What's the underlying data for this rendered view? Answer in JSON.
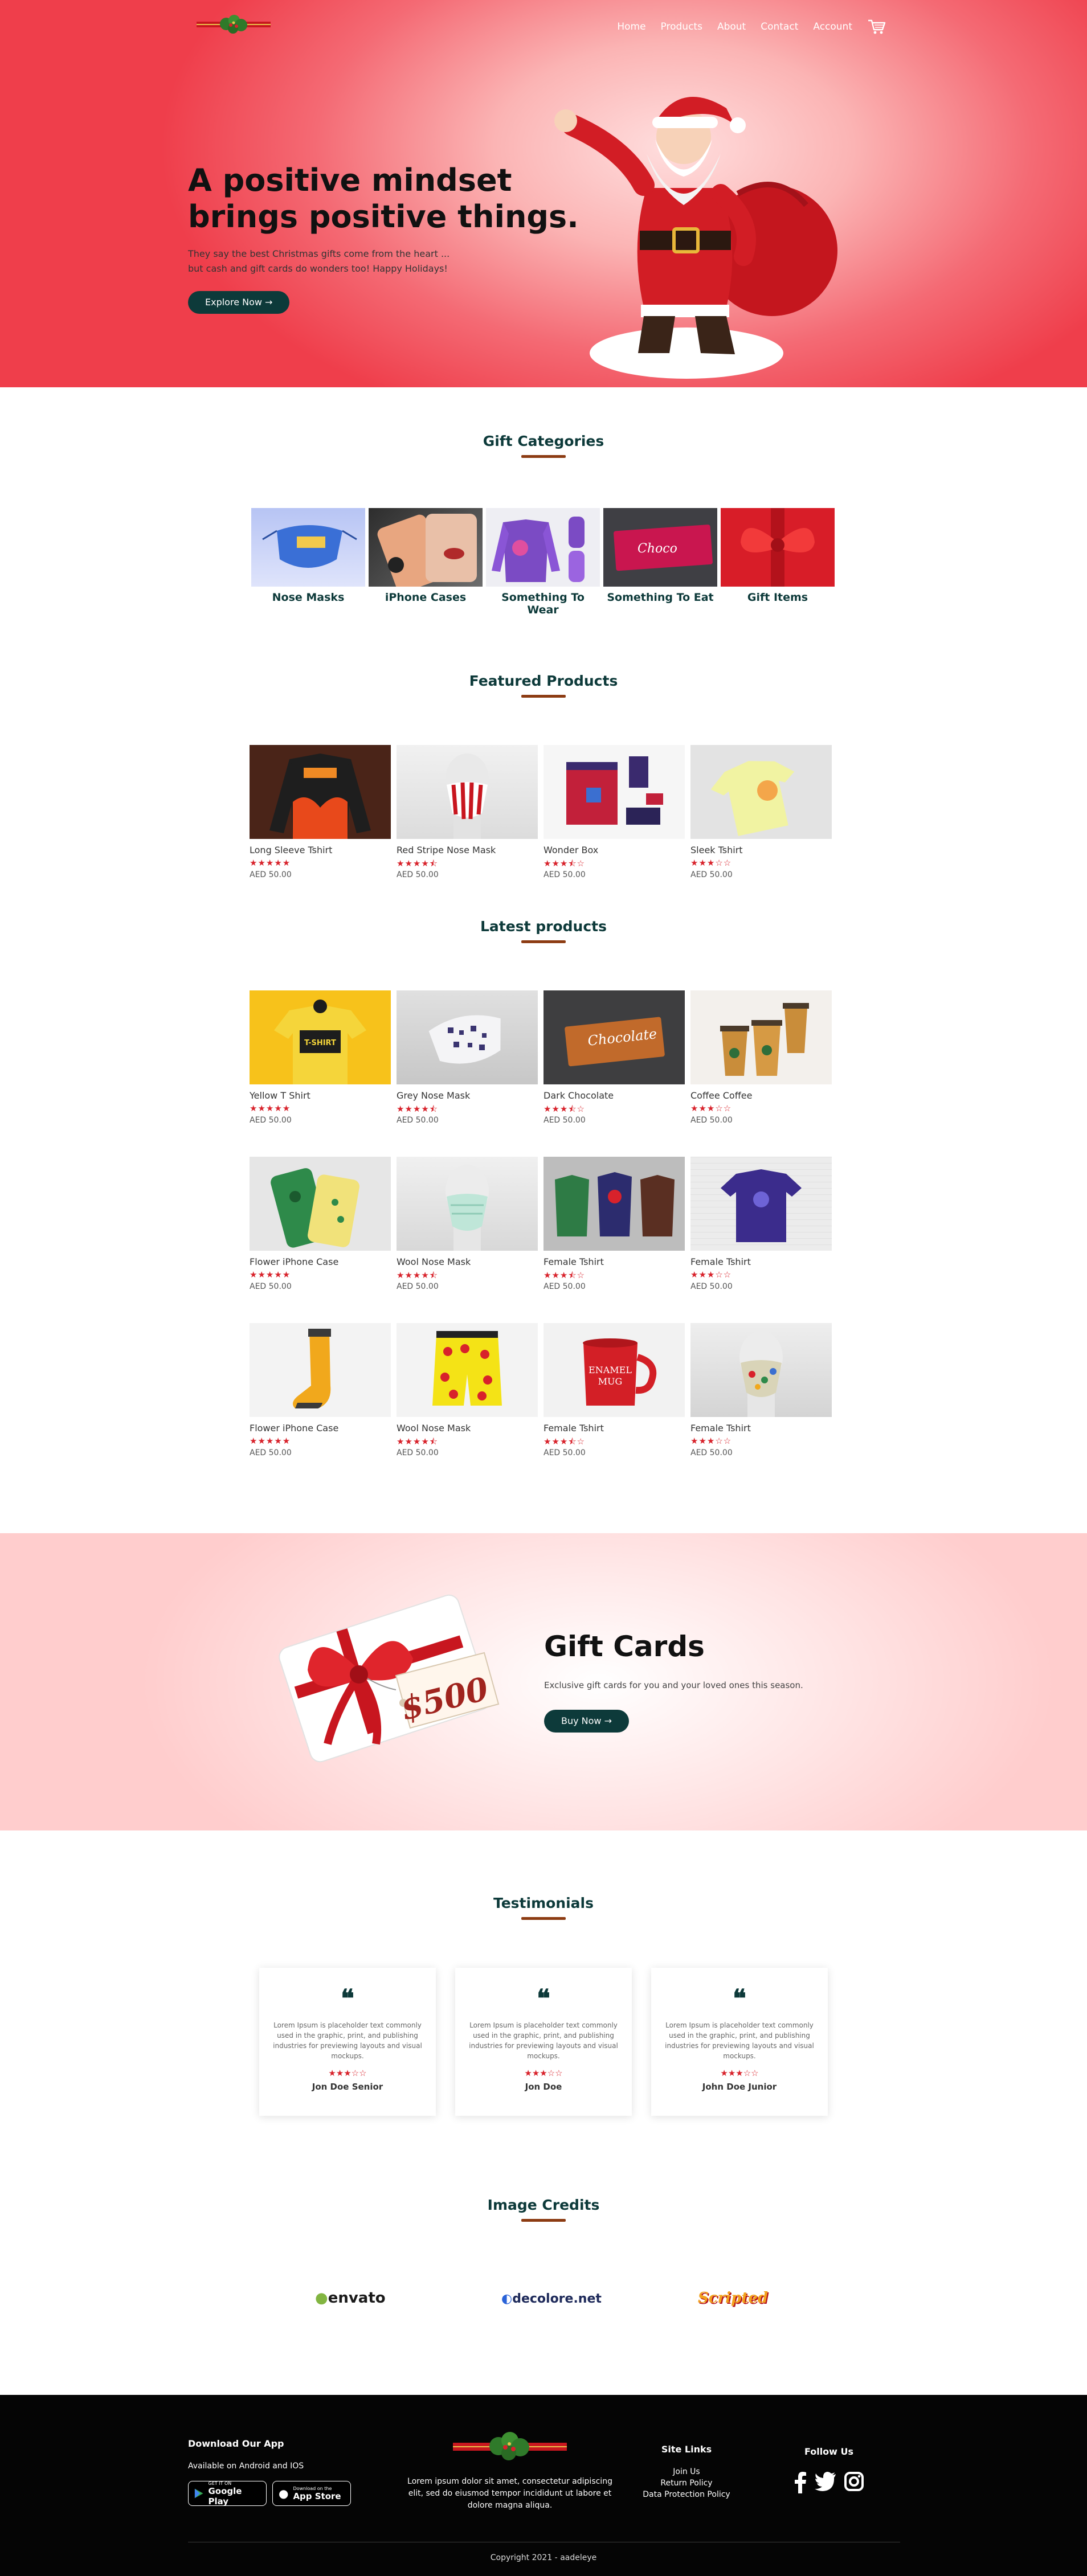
{
  "nav": {
    "items": [
      "Home",
      "Products",
      "About",
      "Contact",
      "Account"
    ],
    "cart_icon": "cart-icon"
  },
  "hero": {
    "title_line1": "A positive mindset",
    "title_line2": "brings positive things.",
    "subtitle_line1": "They say the best Christmas gifts come from the heart ...",
    "subtitle_line2": "but cash and gift cards do wonders too! Happy Holidays!",
    "cta": "Explore Now →"
  },
  "categories": {
    "title": "Gift Categories",
    "items": [
      "Nose Masks",
      "iPhone Cases",
      "Something To Wear",
      "Something To Eat",
      "Gift Items"
    ]
  },
  "featured": {
    "title": "Featured Products",
    "items": [
      {
        "name": "Long Sleeve Tshirt",
        "stars": "★★★★★",
        "rating": 5,
        "price": "AED 50.00"
      },
      {
        "name": "Red Stripe Nose Mask",
        "stars": "★★★★⯪",
        "rating": 4.5,
        "price": "AED 50.00"
      },
      {
        "name": "Wonder Box",
        "stars": "★★★⯪☆",
        "rating": 3.5,
        "price": "AED 50.00"
      },
      {
        "name": "Sleek Tshirt",
        "stars": "★★★☆☆",
        "rating": 3,
        "price": "AED 50.00"
      }
    ]
  },
  "latest": {
    "title": "Latest products",
    "row1": [
      {
        "name": "Yellow T Shirt",
        "stars": "★★★★★",
        "rating": 5,
        "price": "AED 50.00"
      },
      {
        "name": "Grey Nose Mask",
        "stars": "★★★★⯪",
        "rating": 4.5,
        "price": "AED 50.00"
      },
      {
        "name": "Dark Chocolate",
        "stars": "★★★⯪☆",
        "rating": 3.5,
        "price": "AED 50.00"
      },
      {
        "name": "Coffee Coffee",
        "stars": "★★★☆☆",
        "rating": 3,
        "price": "AED 50.00"
      }
    ],
    "row2": [
      {
        "name": "Flower iPhone Case",
        "stars": "★★★★★",
        "rating": 5,
        "price": "AED 50.00"
      },
      {
        "name": "Wool Nose Mask",
        "stars": "★★★★⯪",
        "rating": 4.5,
        "price": "AED 50.00"
      },
      {
        "name": "Female Tshirt",
        "stars": "★★★⯪☆",
        "rating": 3.5,
        "price": "AED 50.00"
      },
      {
        "name": "Female Tshirt",
        "stars": "★★★☆☆",
        "rating": 3,
        "price": "AED 50.00"
      }
    ],
    "row3": [
      {
        "name": "Flower iPhone Case",
        "stars": "★★★★★",
        "rating": 5,
        "price": "AED 50.00"
      },
      {
        "name": "Wool Nose Mask",
        "stars": "★★★★⯪",
        "rating": 4.5,
        "price": "AED 50.00"
      },
      {
        "name": "Female Tshirt",
        "stars": "★★★⯪☆",
        "rating": 3.5,
        "price": "AED 50.00"
      },
      {
        "name": "Female Tshirt",
        "stars": "★★★☆☆",
        "rating": 3,
        "price": "AED 50.00"
      }
    ]
  },
  "giftcards": {
    "title": "Gift Cards",
    "text": "Exclusive gift cards for you and your loved ones this season.",
    "cta": "Buy Now →",
    "card_value": "$500"
  },
  "testimonials": {
    "title": "Testimonials",
    "items": [
      {
        "text": "Lorem Ipsum is placeholder text commonly used in the graphic, print, and publishing industries for previewing layouts and visual mockups.",
        "stars": "★★★☆☆",
        "rating": 3,
        "name": "Jon Doe Senior"
      },
      {
        "text": "Lorem Ipsum is placeholder text commonly used in the graphic, print, and publishing industries for previewing layouts and visual mockups.",
        "stars": "★★★☆☆",
        "rating": 3,
        "name": "Jon Doe"
      },
      {
        "text": "Lorem Ipsum is placeholder text commonly used in the graphic, print, and publishing industries for previewing layouts and visual mockups.",
        "stars": "★★★☆☆",
        "rating": 3,
        "name": "John Doe Junior"
      }
    ]
  },
  "credits": {
    "title": "Image Credits",
    "items": [
      "envato",
      "decolore.net",
      "Scripted"
    ]
  },
  "footer": {
    "download_title": "Download Our App",
    "download_sub": "Available on Android and IOS",
    "google_small": "GET IT ON",
    "google_big": "Google Play",
    "apple_small": "Download on the",
    "apple_big": "App Store",
    "about_text": "Lorem ipsum dolor sit amet, consectetur adipiscing elit, sed do eiusmod tempor incididunt ut labore et dolore magna aliqua.",
    "links_title": "Site Links",
    "links": [
      "Join Us",
      "Return Policy",
      "Data Protection Policy"
    ],
    "follow_title": "Follow Us",
    "copyright": "Copyright 2021 - aadeleye"
  },
  "colors": {
    "accent": "#0d3a3a",
    "title_bar": "#8c3b12",
    "star": "#d8222b",
    "hero_red": "#ef3e4b"
  }
}
